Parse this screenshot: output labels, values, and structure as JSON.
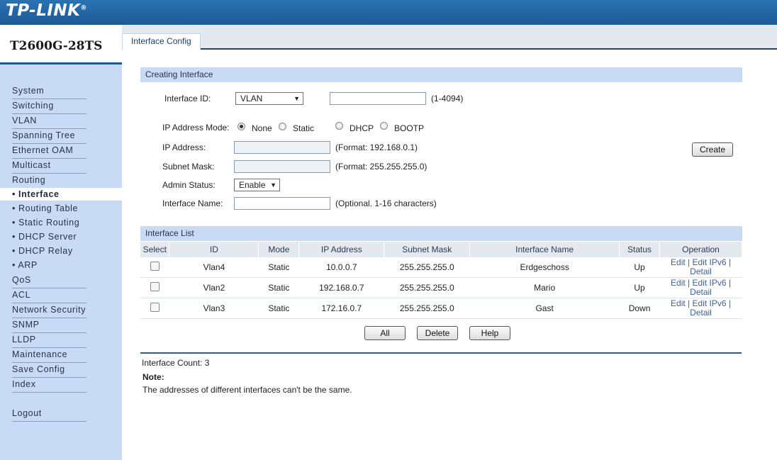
{
  "brand": {
    "logo": "TP-LINK",
    "trademark": "®",
    "model": "T2600G-28TS"
  },
  "tabs": [
    {
      "label": "Interface Config"
    }
  ],
  "sidebar": {
    "items": [
      {
        "label": "System"
      },
      {
        "label": "Switching"
      },
      {
        "label": "VLAN"
      },
      {
        "label": "Spanning Tree"
      },
      {
        "label": "Ethernet OAM"
      },
      {
        "label": "Multicast"
      },
      {
        "label": "Routing"
      }
    ],
    "active": "• Interface",
    "subitems": [
      {
        "label": "• Routing Table"
      },
      {
        "label": "• Static Routing"
      },
      {
        "label": "• DHCP Server"
      },
      {
        "label": "• DHCP Relay"
      },
      {
        "label": "• ARP"
      }
    ],
    "items2": [
      {
        "label": "QoS"
      },
      {
        "label": "ACL"
      },
      {
        "label": "Network Security"
      },
      {
        "label": "SNMP"
      },
      {
        "label": "LLDP"
      },
      {
        "label": "Maintenance"
      },
      {
        "label": "Save Config"
      },
      {
        "label": "Index"
      }
    ],
    "logout": "Logout"
  },
  "create": {
    "header": "Creating Interface",
    "interface_id_label": "Interface ID:",
    "interface_id_type": "VLAN",
    "interface_id_value": "",
    "interface_id_hint": "(1-4094)",
    "ip_mode_label": "IP Address Mode:",
    "ip_modes": [
      "None",
      "Static",
      "DHCP",
      "BOOTP"
    ],
    "ip_mode_selected": "None",
    "ip_label": "IP Address:",
    "ip_hint": "(Format: 192.168.0.1)",
    "mask_label": "Subnet Mask:",
    "mask_hint": "(Format: 255.255.255.0)",
    "admin_label": "Admin Status:",
    "admin_value": "Enable",
    "name_label": "Interface Name:",
    "name_hint": "(Optional. 1-16 characters)",
    "create_button": "Create"
  },
  "list": {
    "header": "Interface List",
    "columns": [
      "Select",
      "ID",
      "Mode",
      "IP Address",
      "Subnet Mask",
      "Interface Name",
      "Status",
      "Operation"
    ],
    "rows": [
      {
        "id": "Vlan4",
        "mode": "Static",
        "ip": "10.0.0.7",
        "mask": "255.255.255.0",
        "name": "Erdgeschoss",
        "status": "Up"
      },
      {
        "id": "Vlan2",
        "mode": "Static",
        "ip": "192.168.0.7",
        "mask": "255.255.255.0",
        "name": "Mario",
        "status": "Up"
      },
      {
        "id": "Vlan3",
        "mode": "Static",
        "ip": "172.16.0.7",
        "mask": "255.255.255.0",
        "name": "Gast",
        "status": "Down"
      }
    ],
    "op_line1": "Edit | Edit IPv6 |",
    "op_line2": "Detail",
    "buttons": {
      "all": "All",
      "delete": "Delete",
      "help": "Help"
    }
  },
  "footer": {
    "count": "Interface Count: 3",
    "note_label": "Note:",
    "note_text": "The addresses of different interfaces can't be the same."
  },
  "colors": {
    "header_blue": "#1d5a95",
    "sidebar": "#c9daf4",
    "link": "#3a5fa6"
  }
}
